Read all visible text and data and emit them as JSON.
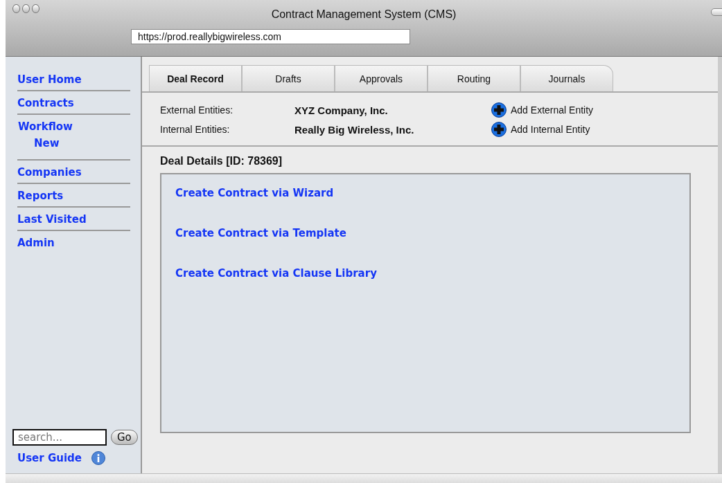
{
  "window": {
    "title": "Contract Management System (CMS)",
    "url": "https://prod.reallybigwireless.com"
  },
  "sidebar": {
    "items": [
      {
        "label": "User Home"
      },
      {
        "label": "Contracts"
      },
      {
        "label": "Workflow",
        "children": [
          {
            "label": "New"
          }
        ]
      },
      {
        "label": "Companies"
      },
      {
        "label": "Reports"
      },
      {
        "label": "Last Visited"
      },
      {
        "label": "Admin"
      }
    ],
    "search": {
      "placeholder": "search...",
      "button": "Go"
    },
    "guide": "User Guide"
  },
  "tabs": [
    {
      "label": "Deal Record",
      "selected": true
    },
    {
      "label": "Drafts",
      "selected": false
    },
    {
      "label": "Approvals",
      "selected": false
    },
    {
      "label": "Routing",
      "selected": false
    },
    {
      "label": "Journals",
      "selected": false
    }
  ],
  "entities": [
    {
      "label": "External Entities:",
      "value": "XYZ Company, Inc.",
      "action": "Add External Entity"
    },
    {
      "label": "Internal Entities:",
      "value": "Really Big Wireless, Inc.",
      "action": "Add Internal Entity"
    }
  ],
  "deal": {
    "title": "Deal Details [ID: 78369]",
    "links": [
      "Create Contract via Wizard",
      "Create Contract via Template",
      "Create Contract via Clause Library"
    ]
  }
}
